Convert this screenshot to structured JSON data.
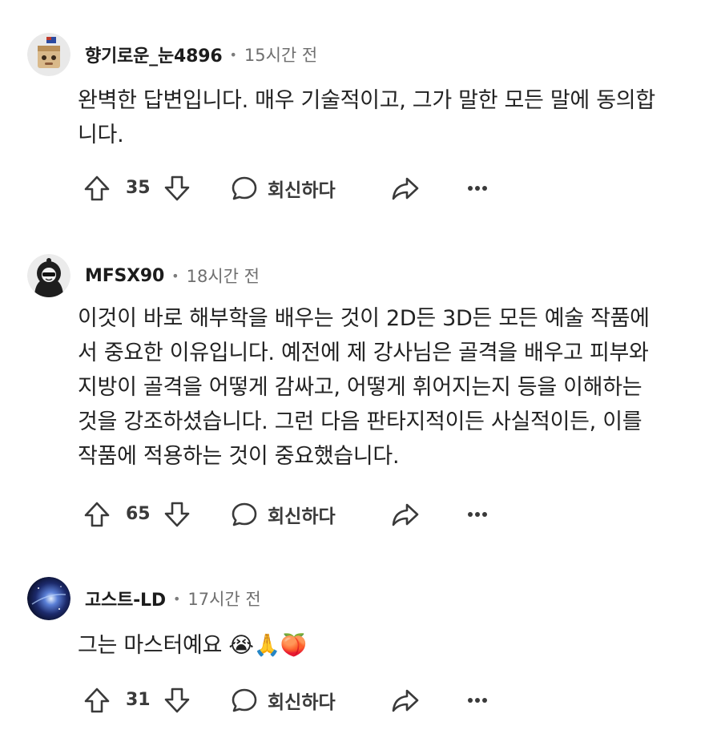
{
  "comments": [
    {
      "username": "향기로운_눈4896",
      "time": "15시간 전",
      "body": "완벽한 답변입니다. 매우 기술적이고, 그가 말한 모든 말에 동의합\n니다.",
      "votes": "35",
      "reply_label": "회신하다",
      "avatar": "cartoon-box-avatar"
    },
    {
      "username": "MFSX90",
      "time": "18시간 전",
      "body": "이것이 바로 해부학을 배우는 것이 2D든 3D든 모든 예술 작품에\n서 중요한 이유입니다. 예전에 제 강사님은 골격을 배우고 피부와\n지방이 골격을 어떻게 감싸고, 어떻게 휘어지는지 등을 이해하는\n것을 강조하셨습니다. 그런 다음 판타지적이든 사실적이든, 이를\n작품에 적용하는 것이 중요했습니다.",
      "votes": "65",
      "reply_label": "회신하다",
      "avatar": "hooded-figure-avatar"
    },
    {
      "username": "고스트-LD",
      "time": "17시간 전",
      "body": "그는 마스터예요 😭🙏🍑",
      "votes": "31",
      "reply_label": "회신하다",
      "avatar": "galaxy-avatar"
    }
  ],
  "separator": "•",
  "icons": {
    "upvote": "upvote-arrow-icon",
    "downvote": "downvote-arrow-icon",
    "reply": "speech-bubble-icon",
    "share": "share-arrow-icon",
    "more": "more-dots-icon"
  },
  "colors": {
    "text": "#222222",
    "muted": "#6f6f6f",
    "icon": "#3a3a3a"
  }
}
